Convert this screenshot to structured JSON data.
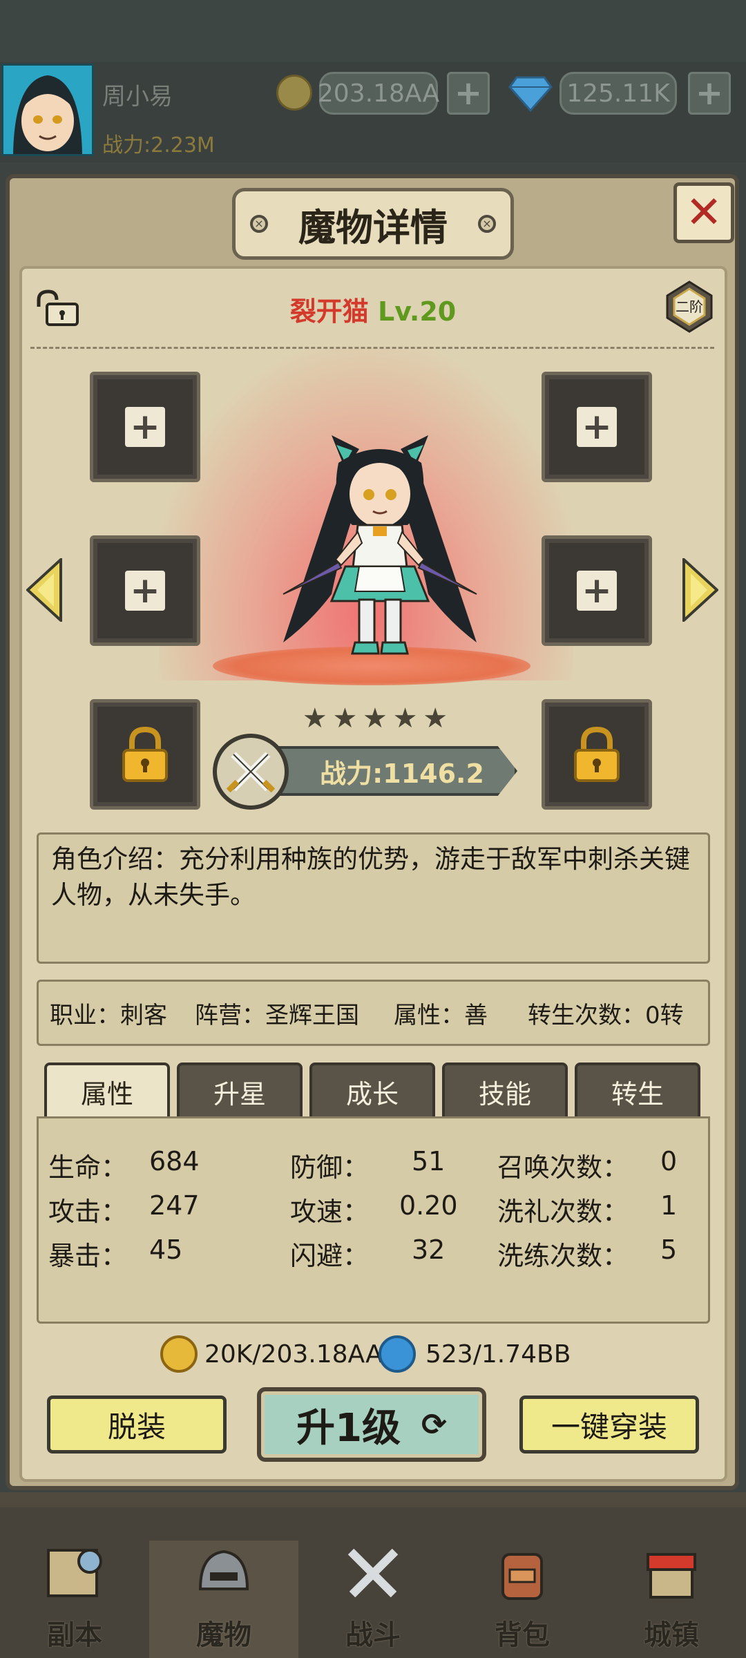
{
  "top": {
    "player_name": "周小易",
    "power": "战力:2.23M",
    "gold": "203.18AA",
    "gems": "125.11K",
    "add_symbol": "+"
  },
  "panel": {
    "title": "魔物详情",
    "close_symbol": "✕",
    "monster_name": "裂开猫",
    "monster_level": "Lv.20",
    "tier": "二阶",
    "plus_symbol": "+",
    "stars": 5,
    "power": "战力:1146.2",
    "description": "角色介绍：充分利用种族的优势，游走于敌军中刺杀关键人物，从未失手。",
    "info": {
      "job": "职业：刺客",
      "camp": "阵营：圣辉王国",
      "attribute": "属性：善",
      "rebirth": "转生次数：0转"
    },
    "tabs": [
      "属性",
      "升星",
      "成长",
      "技能",
      "转生"
    ],
    "stats": {
      "hp_label": "生命：",
      "hp": "684",
      "atk_label": "攻击：",
      "atk": "247",
      "crit_label": "暴击：",
      "crit": "45",
      "def_label": "防御：",
      "def": "51",
      "spd_label": "攻速：",
      "spd": "0.20",
      "eva_label": "闪避：",
      "eva": "32",
      "summon_label": "召唤次数：",
      "summon": "0",
      "baptism_label": "洗礼次数：",
      "baptism": "1",
      "refine_label": "洗练次数：",
      "refine": "5"
    },
    "cost_gold": "20K/203.18AA",
    "cost_gem": "523/1.74BB",
    "btn_unequip": "脱装",
    "btn_levelup": "升1级",
    "btn_equip_all": "一键穿装"
  },
  "nav": [
    "副本",
    "魔物",
    "战斗",
    "背包",
    "城镇"
  ],
  "colors": {
    "accent_red": "#d33a2b",
    "accent_green": "#5f9a1f",
    "gold_text": "#f0dfa3"
  }
}
